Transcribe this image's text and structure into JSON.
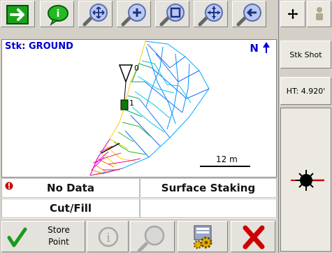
{
  "header": {
    "stakeout_label": "Stk: GROUND",
    "north_label": "N"
  },
  "map": {
    "point_label_top": "0",
    "point_label_mid": "1",
    "scale_label": "12 m"
  },
  "info": {
    "status": "No Data",
    "mode": "Surface Staking",
    "cut_fill_label": "Cut/Fill",
    "cut_fill_value": ""
  },
  "right_panel": {
    "stake_shot_label": "Stk Shot",
    "height_label": "HT: 4.920'"
  },
  "bottom": {
    "store_point_line1": "Store",
    "store_point_line2": "Point"
  },
  "colors": {
    "accept_green": "#1a9a1a",
    "cancel_red": "#cc0000",
    "header_blue": "#0000d0"
  }
}
